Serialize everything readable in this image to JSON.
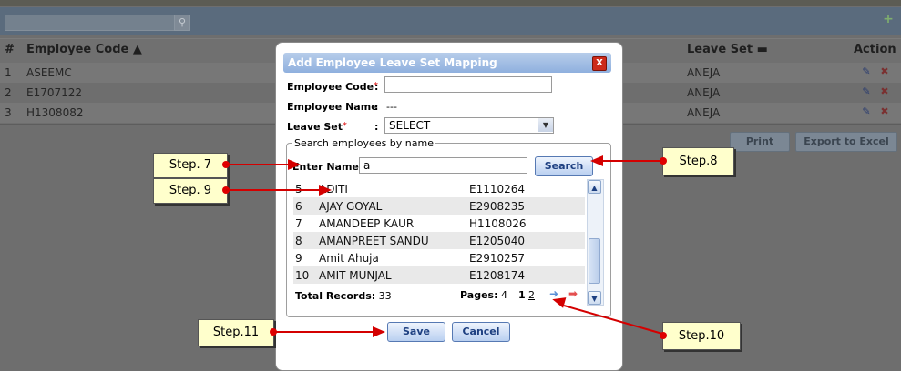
{
  "grid": {
    "headers": {
      "num": "#",
      "code": "Employee Code ▲",
      "leave_set": "Leave Set ▬",
      "action": "Action"
    },
    "rows": [
      {
        "num": "1",
        "code": "ASEEMC",
        "leave_set": "ANEJA"
      },
      {
        "num": "2",
        "code": "E1707122",
        "leave_set": "ANEJA"
      },
      {
        "num": "3",
        "code": "H1308082",
        "leave_set": "ANEJA"
      }
    ],
    "print_label": "Print",
    "export_label": "Export to Excel"
  },
  "modal": {
    "title": "Add Employee Leave Set Mapping",
    "employee_code_label": "Employee Code",
    "employee_code_value": "",
    "employee_name_label": "Employee Name",
    "employee_name_value": "---",
    "leave_set_label": "Leave Set",
    "leave_set_value": "SELECT",
    "required_mark": "*",
    "colon": ":",
    "search_group_legend": "Search employees by name",
    "enter_name_label": "Enter Name :",
    "enter_name_value": "a",
    "search_button": "Search",
    "results": [
      {
        "num": "5",
        "name": "ADITI",
        "code": "E1110264"
      },
      {
        "num": "6",
        "name": "AJAY GOYAL",
        "code": "E2908235"
      },
      {
        "num": "7",
        "name": "AMANDEEP KAUR",
        "code": "H1108026"
      },
      {
        "num": "8",
        "name": "AMANPREET SANDU",
        "code": "E1205040"
      },
      {
        "num": "9",
        "name": "Amit Ahuja",
        "code": "E2910257"
      },
      {
        "num": "10",
        "name": "AMIT MUNJAL",
        "code": "E1208174"
      }
    ],
    "total_records_label": "Total Records:",
    "total_records_value": "33",
    "pages_label": "Pages:",
    "pages_value": "4",
    "page_1": "1",
    "page_2": "2",
    "save_button": "Save",
    "cancel_button": "Cancel"
  },
  "callouts": {
    "step7": "Step. 7",
    "step8": "Step.8",
    "step9": "Step. 9",
    "step10": "Step.10",
    "step11": "Step.11"
  },
  "colors": {
    "annotation_red": "#d40000",
    "callout_bg": "#ffffcc",
    "modal_title": "#8fb0de"
  }
}
